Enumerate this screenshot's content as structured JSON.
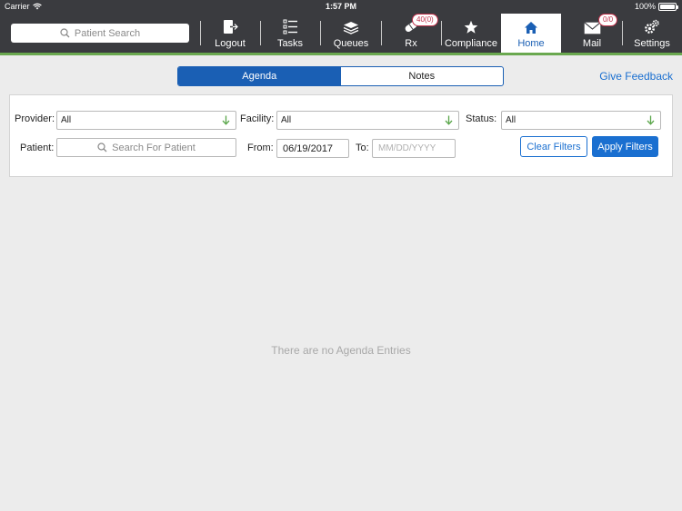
{
  "status_bar": {
    "carrier": "Carrier",
    "time": "1:57 PM",
    "battery": "100%"
  },
  "nav": {
    "search_placeholder": "Patient Search",
    "items": [
      {
        "label": "Logout",
        "icon": "logout-icon"
      },
      {
        "label": "Tasks",
        "icon": "tasks-icon"
      },
      {
        "label": "Queues",
        "icon": "queues-icon"
      },
      {
        "label": "Rx",
        "icon": "rx-icon",
        "badge": "40(0)"
      },
      {
        "label": "Compliance",
        "icon": "star-icon"
      },
      {
        "label": "Home",
        "icon": "home-icon",
        "active": true
      },
      {
        "label": "Mail",
        "icon": "mail-icon",
        "badge": "0/0"
      },
      {
        "label": "Settings",
        "icon": "gear-icon"
      }
    ]
  },
  "tabs": [
    {
      "label": "Agenda",
      "active": true
    },
    {
      "label": "Notes",
      "active": false
    }
  ],
  "feedback_link": "Give Feedback",
  "filters": {
    "provider_label": "Provider:",
    "provider_value": "All",
    "facility_label": "Facility:",
    "facility_value": "All",
    "status_label": "Status:",
    "status_value": "All",
    "patient_label": "Patient:",
    "patient_placeholder": "Search For Patient",
    "from_label": "From:",
    "from_value": "06/19/2017",
    "to_label": "To:",
    "to_placeholder": "MM/DD/YYYY",
    "clear_label": "Clear Filters",
    "apply_label": "Apply Filters"
  },
  "empty_message": "There are no Agenda Entries",
  "colors": {
    "nav_bg": "#3a3b3f",
    "accent": "#1a5fb4",
    "link": "#1a6fd0",
    "green_bar": "#6aa84f",
    "badge": "#c0304a"
  }
}
